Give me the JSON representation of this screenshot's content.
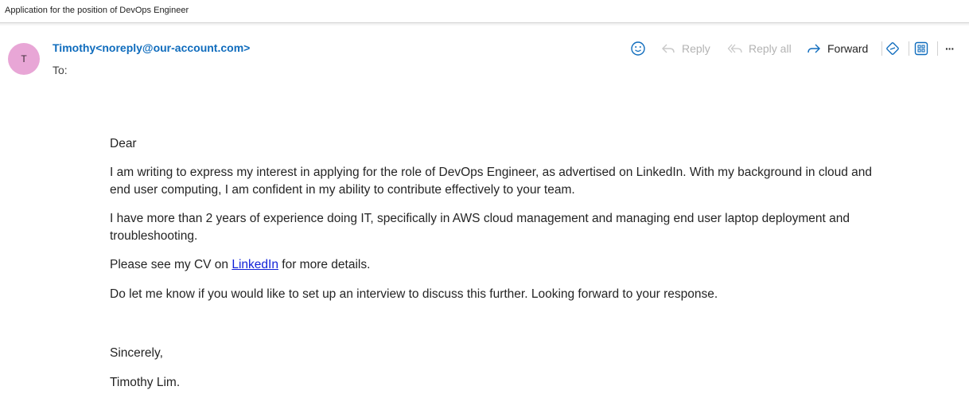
{
  "subject": "Application for the position of DevOps Engineer",
  "sender": {
    "initial": "T",
    "display": "Timothy<noreply@our-account.com>",
    "to_label": "To:"
  },
  "toolbar": {
    "emoji_icon": "smiley-icon",
    "reply_label": "Reply",
    "reply_all_label": "Reply all",
    "forward_label": "Forward",
    "more_label": "···"
  },
  "message": {
    "greeting": "Dear",
    "paragraph1": "I am writing to express my interest in applying for the role of DevOps Engineer, as advertised on LinkedIn. With my background in cloud and end user computing, I am confident in my ability to contribute effectively to your team.",
    "paragraph2": "I have more than 2 years of experience doing IT, specifically in AWS cloud management and managing end user laptop deployment and troubleshooting.",
    "cv_prefix": "Please see my CV on ",
    "cv_link": "LinkedIn",
    "cv_suffix": " for more details.",
    "paragraph4": "Do let me know if you would like to set up an interview to discuss this further. Looking forward to your response.",
    "closing": "Sincerely,",
    "signature": "Timothy Lim."
  },
  "colors": {
    "accent": "#0f6cbd",
    "avatar_bg": "#e8a6d6",
    "link": "#0f1fd8",
    "disabled": "#b3b3b3"
  }
}
